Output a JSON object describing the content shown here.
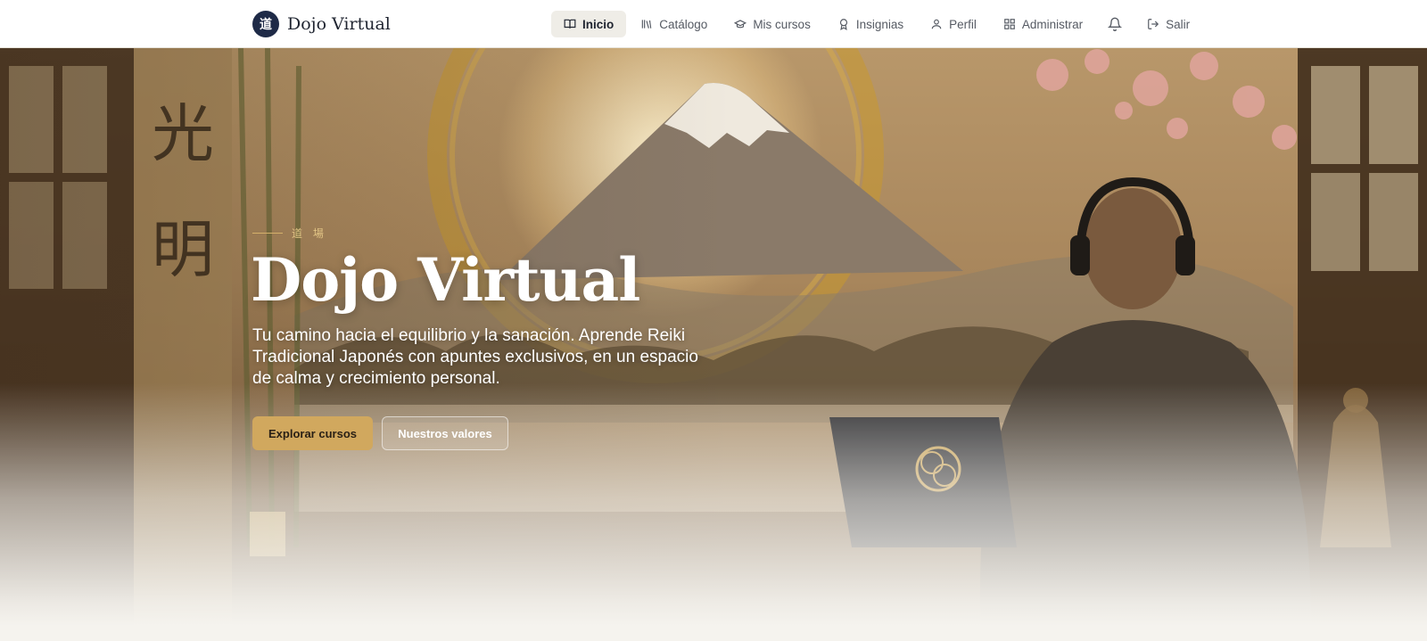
{
  "brand": {
    "logo_glyph": "道",
    "name": "Dojo Virtual"
  },
  "nav": {
    "items": [
      {
        "label": "Inicio",
        "icon": "book-open-icon",
        "active": true
      },
      {
        "label": "Catálogo",
        "icon": "library-icon",
        "active": false
      },
      {
        "label": "Mis cursos",
        "icon": "graduation-cap-icon",
        "active": false
      },
      {
        "label": "Insignias",
        "icon": "award-icon",
        "active": false
      },
      {
        "label": "Perfil",
        "icon": "user-icon",
        "active": false
      },
      {
        "label": "Administrar",
        "icon": "grid-icon",
        "active": false
      },
      {
        "label": "",
        "icon": "bell-icon",
        "active": false
      },
      {
        "label": "Salir",
        "icon": "logout-icon",
        "active": false
      }
    ]
  },
  "hero": {
    "eyebrow": "道 場",
    "title": "Dojo Virtual",
    "subtitle": "Tu camino hacia el equilibrio y la sanación. Aprende Reiki Tradicional Japonés con apuntes exclusivos, en un espacio de calma y crecimiento personal.",
    "primary_button": "Explorar cursos",
    "secondary_button": "Nuestros valores"
  },
  "colors": {
    "brand_navy": "#1e2a47",
    "accent_gold": "#d1a85e",
    "page_background": "#f5f3ee"
  }
}
